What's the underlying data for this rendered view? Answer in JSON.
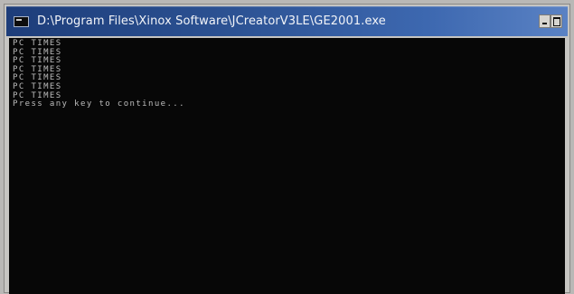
{
  "window": {
    "title": "D:\\Program Files\\Xinox Software\\JCreatorV3LE\\GE2001.exe",
    "icon": "console-icon",
    "buttons": {
      "minimize": "minimize-icon",
      "maximize": "maximize-icon"
    }
  },
  "console": {
    "lines": [
      "PC TIMES",
      "PC TIMES",
      "PC TIMES",
      "PC TIMES",
      "PC TIMES",
      "PC TIMES",
      "PC TIMES",
      "Press any key to continue..."
    ]
  },
  "colors": {
    "title_bar": "#2c5293",
    "console_background": "#070707",
    "console_text": "#bdbdbd"
  }
}
